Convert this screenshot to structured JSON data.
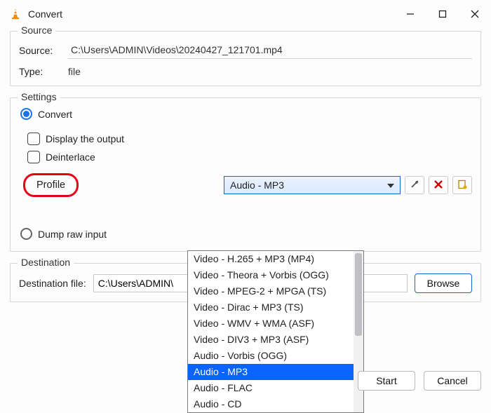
{
  "window": {
    "title": "Convert"
  },
  "source_group": {
    "label": "Source",
    "source_lbl": "Source:",
    "source_val": "C:\\Users\\ADMIN\\Videos\\20240427_121701.mp4",
    "type_lbl": "Type:",
    "type_val": "file"
  },
  "settings_group": {
    "label": "Settings",
    "convert_lbl": "Convert",
    "display_lbl": "Display the output",
    "deinterlace_lbl": "Deinterlace",
    "profile_lbl": "Profile",
    "profile_selected": "Audio - MP3",
    "profile_options": [
      "Video - H.265 + MP3 (MP4)",
      "Video - Theora + Vorbis (OGG)",
      "Video - MPEG-2 + MPGA (TS)",
      "Video - Dirac + MP3 (TS)",
      "Video - WMV + WMA (ASF)",
      "Video - DIV3 + MP3 (ASF)",
      "Audio - Vorbis (OGG)",
      "Audio - MP3",
      "Audio - FLAC",
      "Audio - CD"
    ],
    "profile_selected_index": 7,
    "dump_lbl": "Dump raw input"
  },
  "destination_group": {
    "label": "Destination",
    "dest_lbl": "Destination file:",
    "dest_val": "C:\\Users\\ADMIN\\",
    "browse": "Browse"
  },
  "footer": {
    "start": "Start",
    "cancel": "Cancel"
  }
}
